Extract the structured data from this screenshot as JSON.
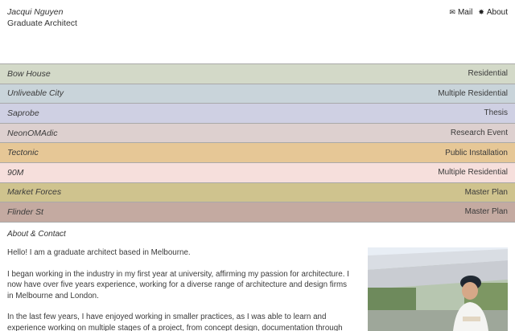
{
  "header": {
    "name": "Jacqui Nguyen",
    "role": "Graduate Architect",
    "nav": [
      {
        "icon": "✉",
        "icon_name": "mail-icon",
        "label": "Mail"
      },
      {
        "icon": "✸",
        "icon_name": "star-burst-icon",
        "label": "About"
      }
    ]
  },
  "projects": [
    {
      "name": "Bow House",
      "type": "Residential",
      "color": "#d3d9c8"
    },
    {
      "name": "Unliveable City",
      "type": "Multiple Residential",
      "color": "#c9d4da"
    },
    {
      "name": "Saprobe",
      "type": "Thesis",
      "color": "#cfd0e3"
    },
    {
      "name": "NeonOMAdic",
      "type": "Research Event",
      "color": "#ddd0cf"
    },
    {
      "name": "Tectonic",
      "type": "Public Installation",
      "color": "#e6c796"
    },
    {
      "name": "90M",
      "type": "Multiple Residential",
      "color": "#f6dfdc"
    },
    {
      "name": "Market Forces",
      "type": "Master Plan",
      "color": "#cfc38e"
    },
    {
      "name": "Flinder St",
      "type": "Master Plan",
      "color": "#c4aaa1"
    }
  ],
  "about": {
    "heading": "About & Contact",
    "paragraphs": [
      "Hello! I am a graduate architect based in Melbourne.",
      "I began working in the industry in my first year at university, affirming my passion for architecture. I now have over five years experience, working for a diverse range of architecture and design firms in Melbourne and London.",
      "In the last few years, I have enjoyed working in smaller practices, as I was able to learn and experience working on multiple stages of a project, from concept design, documentation through"
    ]
  }
}
